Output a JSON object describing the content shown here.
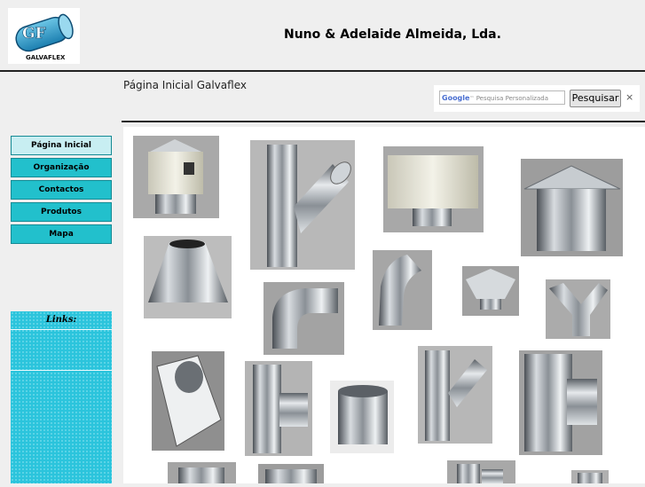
{
  "header": {
    "company_name": "Nuno & Adelaide Almeida, Lda.",
    "logo_text": "GF",
    "logo_caption": "GALVAFLEX"
  },
  "page": {
    "heading": "Página Inicial Galvaflex"
  },
  "search": {
    "brand": "Google",
    "placeholder": "Pesquisa Personalizada",
    "button_label": "Pesquisar",
    "close_symbol": "×"
  },
  "nav": {
    "items": [
      {
        "label": "Página Inicial",
        "active": true
      },
      {
        "label": "Organização"
      },
      {
        "label": "Contactos"
      },
      {
        "label": "Produtos"
      },
      {
        "label": "Mapa"
      }
    ]
  },
  "links": {
    "title": "Links:"
  },
  "colors": {
    "nav_bg": "#22c0cc",
    "nav_active_bg": "#c8eef2",
    "links_bg": "#2bc4dc",
    "page_bg": "#efefef"
  },
  "gallery": {
    "items": [
      "chimney-cowl-cylindrical",
      "y-branch-45",
      "chimney-cap-cylindrical",
      "chinese-hat-cap",
      "conical-flashing",
      "elbow-90",
      "elbow-45",
      "small-rain-cap",
      "y-branch-equal",
      "square-flashing-plate",
      "tee-90",
      "straight-sleeve",
      "y-branch-reducing",
      "tee-reducing",
      "partial-product-1",
      "partial-product-2",
      "partial-product-3",
      "partial-product-4"
    ]
  }
}
